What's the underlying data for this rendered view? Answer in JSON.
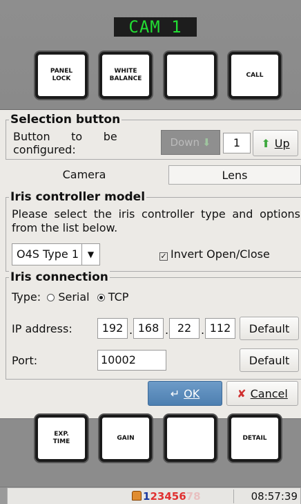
{
  "camera_title": "CAM  1",
  "top_buttons": [
    "PANEL\nLOCK",
    "WHITE\nBALANCE",
    "",
    "CALL"
  ],
  "bottom_buttons": [
    "EXP.\nTIME",
    "GAIN",
    "",
    "DETAIL"
  ],
  "dialog": {
    "selection": {
      "title": "Selection button",
      "label_line1": "Button      to      be",
      "label_line2": "configured:",
      "down_label": "Down",
      "value": "1",
      "up_label": "Up"
    },
    "tabs": [
      "Camera",
      "Lens"
    ],
    "iris_model": {
      "title": "Iris controller model",
      "description": "Please select the iris controller type and options from the list below.",
      "selected": "O4S Type 1",
      "invert_label": "Invert Open/Close",
      "invert_checked": true
    },
    "iris_connection": {
      "title": "Iris connection",
      "type_label": "Type:",
      "serial_label": "Serial",
      "tcp_label": "TCP",
      "selected_type": "TCP",
      "ip_label": "IP address:",
      "ip_octets": [
        "192",
        "168",
        "22",
        "112"
      ],
      "port_label": "Port:",
      "port_value": "10002",
      "default_label": "Default"
    },
    "ok_label": "OK",
    "cancel_label": "Cancel"
  },
  "status": {
    "first_num": "1",
    "nums": [
      "2",
      "3",
      "4",
      "5",
      "6"
    ],
    "dim_nums": [
      "7",
      "8"
    ],
    "time": "08:57:39"
  },
  "colors": {
    "camera_title_fg": "#22dd33",
    "camera_title_bg": "#1d1d1d",
    "ok_button": "#5a8cbd",
    "cancel_icon": "#d03030",
    "arrow_up": "#3da83d"
  }
}
